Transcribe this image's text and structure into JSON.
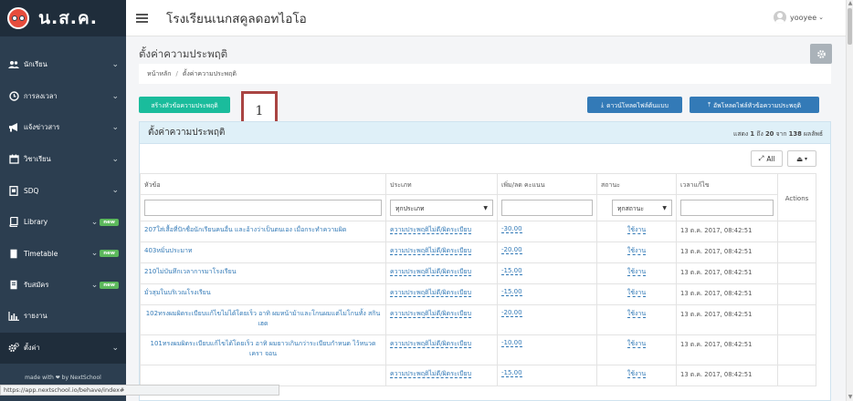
{
  "brand": {
    "name": "น.ส.ค."
  },
  "sidebar": {
    "items": [
      {
        "label": "นักเรียน",
        "icon": "users-icon",
        "badge": ""
      },
      {
        "label": "การลงเวลา",
        "icon": "clock-icon",
        "badge": ""
      },
      {
        "label": "แจ้งข่าวสาร",
        "icon": "bullhorn-icon",
        "badge": ""
      },
      {
        "label": "วิชาเรียน",
        "icon": "calendar-icon",
        "badge": ""
      },
      {
        "label": "SDQ",
        "icon": "file-icon",
        "badge": ""
      },
      {
        "label": "Library",
        "icon": "book-icon",
        "badge": "new"
      },
      {
        "label": "Timetable",
        "icon": "file-icon",
        "badge": "new"
      },
      {
        "label": "รับสมัคร",
        "icon": "file-icon",
        "badge": "new"
      },
      {
        "label": "รายงาน",
        "icon": "bar-chart-icon",
        "badge": ""
      },
      {
        "label": "ตั้งค่า",
        "icon": "cogs-icon",
        "badge": ""
      }
    ],
    "footer": "made with ❤ by NextSchool"
  },
  "topbar": {
    "school_name": "โรงเรียนเนกสคูลดอทไอโอ",
    "user_name": "yooyee"
  },
  "page": {
    "title": "ตั้งค่าความประพฤติ",
    "breadcrumb": [
      "หน้าหลัก",
      "ตั้งค่าความประพฤติ"
    ],
    "create_button": "สร้างหัวข้อความประพฤติ",
    "download_template": "ดาวน์โหลดไฟล์ต้นแบบ",
    "upload_topics": "อัพโหลดไฟล์หัวข้อความประพฤติ",
    "callout_number": "1"
  },
  "panel": {
    "title": "ตั้งค่าความประพฤติ",
    "summary_prefix": "แสดง",
    "summary_from": "1",
    "summary_mid1": "ถึง",
    "summary_to": "20",
    "summary_mid2": "จาก",
    "summary_total": "138",
    "summary_suffix": "ผลลัพธ์",
    "all_button": "All"
  },
  "table": {
    "headers": {
      "topic": "หัวข้อ",
      "type": "ประเภท",
      "score": "เพิ่ม/ลด คะแนน",
      "status": "สถานะ",
      "updated": "เวลาแก้ไข",
      "actions": "Actions"
    },
    "filters": {
      "type": "ทุกประเภท",
      "status": "ทุกสถานะ"
    },
    "rows": [
      {
        "topic": "207ใส่เสื้อที่ปักชื่อนักเรียนคนอื่น และอ้างว่าเป็นตนเอง เมื่อกระทำความผิด",
        "type": "ความประพฤติไม่ดี/ผิดระเบียบ",
        "score": "-30.00",
        "status": "ใช้งาน",
        "updated": "13 ต.ค. 2017, 08:42:51"
      },
      {
        "topic": "403หมิ่นประมาท",
        "type": "ความประพฤติไม่ดี/ผิดระเบียบ",
        "score": "-20.00",
        "status": "ใช้งาน",
        "updated": "13 ต.ค. 2017, 08:42:51"
      },
      {
        "topic": "210ไม่บันทึกเวลาการมาโรงเรียน",
        "type": "ความประพฤติไม่ดี/ผิดระเบียบ",
        "score": "-15.00",
        "status": "ใช้งาน",
        "updated": "13 ต.ค. 2017, 08:42:51"
      },
      {
        "topic": "มั่วสุมในบริเวณโรงเรียน",
        "type": "ความประพฤติไม่ดี/ผิดระเบียบ",
        "score": "-15.00",
        "status": "ใช้งาน",
        "updated": "13 ต.ค. 2017, 08:42:51"
      },
      {
        "topic": "102ทรงผมผิดระเบียบแก้ไขไม่ได้โดยเร็ว อาทิ ผมหน้าม้าและโกนผมแต่ไม่โกนทั้ง สกินเฮด",
        "type": "ความประพฤติไม่ดี/ผิดระเบียบ",
        "score": "-20.00",
        "status": "ใช้งาน",
        "updated": "13 ต.ค. 2017, 08:42:51"
      },
      {
        "topic": "101ทรงผมผิดระเบียบแก้ไขได้โดยเร็ว อาทิ ผมยาวเกินกว่าระเบียบกำหนด ไว้หนวดเครา จอน",
        "type": "ความประพฤติไม่ดี/ผิดระเบียบ",
        "score": "-10.00",
        "status": "ใช้งาน",
        "updated": "13 ต.ค. 2017, 08:42:51"
      },
      {
        "topic": "",
        "type": "ความประพฤติไม่ดี/ผิดระเบียบ",
        "score": "-15.00",
        "status": "ใช้งาน",
        "updated": "13 ต.ค. 2017, 08:42:51"
      }
    ]
  },
  "statusbar": {
    "url": "https://app.nextschool.io/behave/index#"
  }
}
